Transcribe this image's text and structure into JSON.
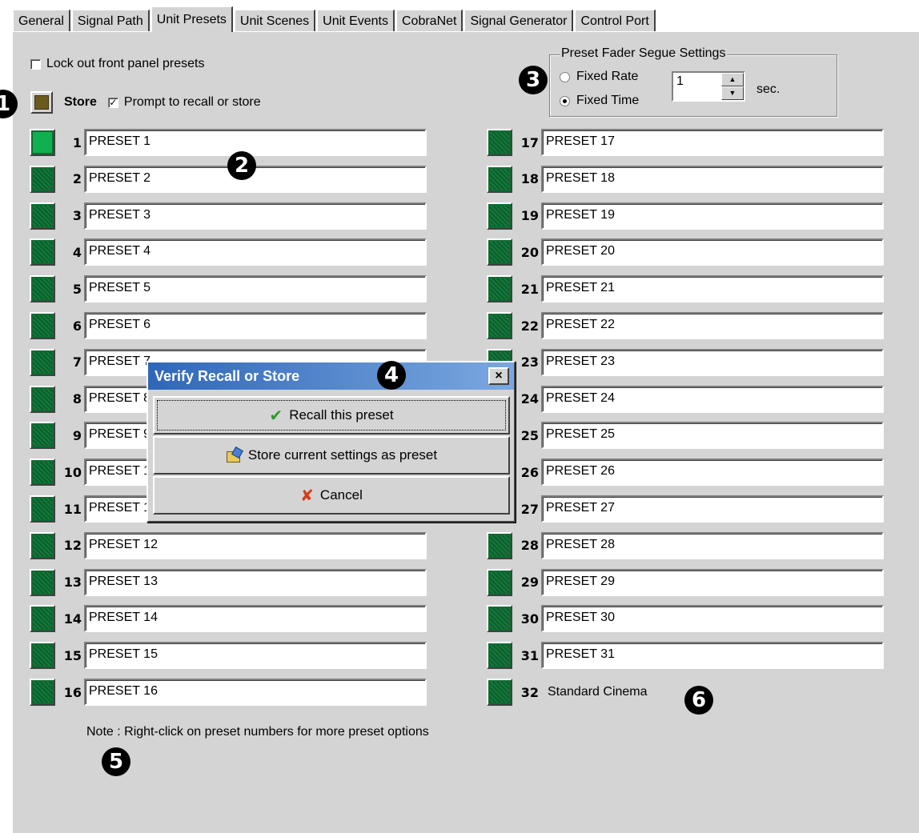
{
  "tabs": [
    "General",
    "Signal Path",
    "Unit Presets",
    "Unit Scenes",
    "Unit Events",
    "CobraNet",
    "Signal Generator",
    "Control Port"
  ],
  "active_tab": "Unit Presets",
  "lock_label": "Lock out front panel presets",
  "store_label": "Store",
  "prompt_label": "Prompt to recall or store",
  "segue": {
    "title": "Preset Fader Segue Settings",
    "fixed_rate": "Fixed Rate",
    "fixed_time": "Fixed Time",
    "value": "1",
    "unit": "sec."
  },
  "presets_left": [
    {
      "num": "1",
      "name": "PRESET 1"
    },
    {
      "num": "2",
      "name": "PRESET 2"
    },
    {
      "num": "3",
      "name": "PRESET 3"
    },
    {
      "num": "4",
      "name": "PRESET 4"
    },
    {
      "num": "5",
      "name": "PRESET 5"
    },
    {
      "num": "6",
      "name": "PRESET 6"
    },
    {
      "num": "7",
      "name": "PRESET 7"
    },
    {
      "num": "8",
      "name": "PRESET 8"
    },
    {
      "num": "9",
      "name": "PRESET 9"
    },
    {
      "num": "10",
      "name": "PRESET 10"
    },
    {
      "num": "11",
      "name": "PRESET 11"
    },
    {
      "num": "12",
      "name": "PRESET 12"
    },
    {
      "num": "13",
      "name": "PRESET 13"
    },
    {
      "num": "14",
      "name": "PRESET 14"
    },
    {
      "num": "15",
      "name": "PRESET 15"
    },
    {
      "num": "16",
      "name": "PRESET 16"
    }
  ],
  "presets_right": [
    {
      "num": "17",
      "name": "PRESET 17"
    },
    {
      "num": "18",
      "name": "PRESET 18"
    },
    {
      "num": "19",
      "name": "PRESET 19"
    },
    {
      "num": "20",
      "name": "PRESET 20"
    },
    {
      "num": "21",
      "name": "PRESET 21"
    },
    {
      "num": "22",
      "name": "PRESET 22"
    },
    {
      "num": "23",
      "name": "PRESET 23"
    },
    {
      "num": "24",
      "name": "PRESET 24"
    },
    {
      "num": "25",
      "name": "PRESET 25"
    },
    {
      "num": "26",
      "name": "PRESET 26"
    },
    {
      "num": "27",
      "name": "PRESET 27"
    },
    {
      "num": "28",
      "name": "PRESET 28"
    },
    {
      "num": "29",
      "name": "PRESET 29"
    },
    {
      "num": "30",
      "name": "PRESET 30"
    },
    {
      "num": "31",
      "name": "PRESET 31"
    },
    {
      "num": "32",
      "name": "Standard Cinema"
    }
  ],
  "note": "Note : Right-click on preset numbers for more preset options",
  "dialog": {
    "title": "Verify Recall or Store",
    "close": "×",
    "recall": "Recall this preset",
    "store": "Store current settings as preset",
    "cancel": "Cancel"
  },
  "callouts": [
    "1",
    "2",
    "3",
    "4",
    "5",
    "6"
  ],
  "colors": {
    "preset_button": "#0f6b33",
    "preset_active": "#10b050",
    "store_button": "#6b5a1e",
    "panel": "#d4d4d4",
    "dialog_title": "#2f66b8"
  }
}
